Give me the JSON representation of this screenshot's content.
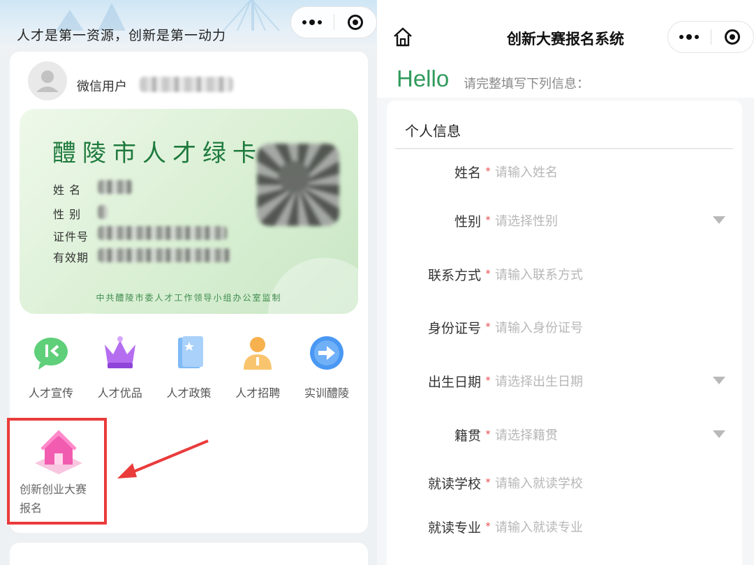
{
  "left": {
    "banner": {
      "slogan": "人才是第一资源，创新是第一动力"
    },
    "user": {
      "name": "微信用户"
    },
    "green_card": {
      "title": "醴陵市人才绿卡",
      "fields": [
        "姓 名",
        "性 别",
        "证件号",
        "有效期"
      ],
      "footer": "中共醴陵市委人才工作领导小组办公室监制"
    },
    "services": [
      {
        "label": "人才宣传",
        "icon": "chat-icon",
        "color": "#4cc36a"
      },
      {
        "label": "人才优品",
        "icon": "crown-icon",
        "color": "#a25bea"
      },
      {
        "label": "人才政策",
        "icon": "book-icon",
        "color": "#5aa5f0"
      },
      {
        "label": "人才招聘",
        "icon": "person-icon",
        "color": "#f5a53c"
      },
      {
        "label": "实训醴陵",
        "icon": "arrow-right-icon",
        "color": "#3d8ff2"
      }
    ],
    "highlight_tile": {
      "label_line1": "创新创业大赛",
      "label_line2": "报名",
      "icon": "house-icon"
    }
  },
  "right": {
    "header": {
      "title": "创新大赛报名系统"
    },
    "hello": "Hello",
    "hello_sub": "请完整填写下列信息：",
    "section_title": "个人信息",
    "fields": [
      {
        "label": "姓名",
        "placeholder": "请输入姓名",
        "dropdown": false
      },
      {
        "label": "性别",
        "placeholder": "请选择性别",
        "dropdown": true
      },
      {
        "label": "联系方式",
        "placeholder": "请输入联系方式",
        "dropdown": false
      },
      {
        "label": "身份证号",
        "placeholder": "请输入身份证号",
        "dropdown": false
      },
      {
        "label": "出生日期",
        "placeholder": "请选择出生日期",
        "dropdown": true
      },
      {
        "label": "籍贯",
        "placeholder": "请选择籍贯",
        "dropdown": true
      },
      {
        "label": "就读学校",
        "placeholder": "请输入就读学校",
        "dropdown": false
      },
      {
        "label": "就读专业",
        "placeholder": "请输入就读专业",
        "dropdown": false
      }
    ],
    "required_mark": "*"
  }
}
